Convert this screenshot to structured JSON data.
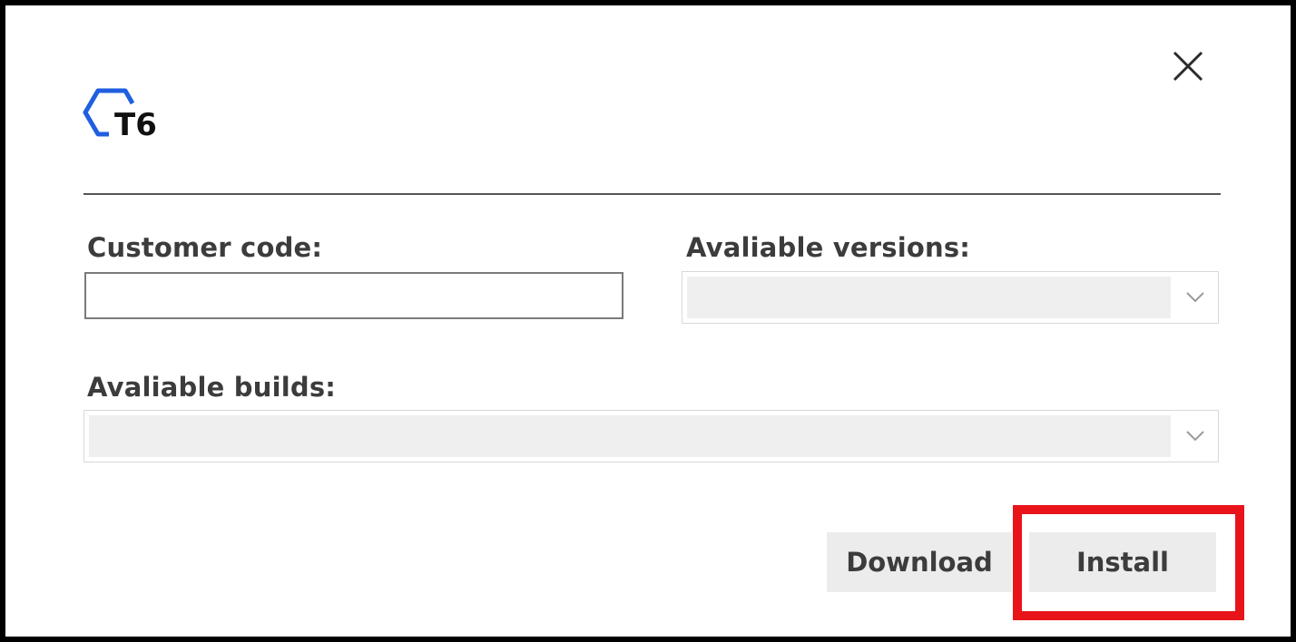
{
  "window": {
    "close_icon": "close-icon",
    "logo_text": "T6",
    "logo_colors": {
      "hex": "#1f5fe0",
      "text": "#111111"
    }
  },
  "form": {
    "customer_code_label": "Customer code:",
    "customer_code_value": "",
    "versions_label": "Avaliable versions:",
    "versions_selected": "",
    "builds_label": "Avaliable builds:",
    "builds_selected": ""
  },
  "actions": {
    "download_label": "Download",
    "install_label": "Install"
  },
  "colors": {
    "highlight": "#e8141a",
    "button_bg": "#ececec",
    "disabled_fill": "#efefef"
  }
}
